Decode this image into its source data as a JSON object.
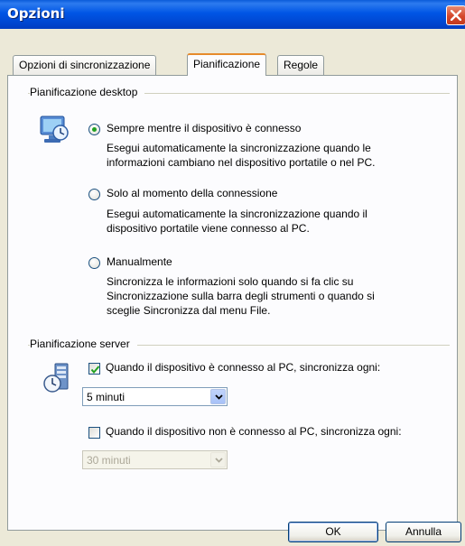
{
  "window": {
    "title": "Opzioni",
    "close_icon": "close-icon"
  },
  "tabs": [
    {
      "label": "Opzioni di sincronizzazione",
      "active": false
    },
    {
      "label": "Pianificazione",
      "active": true
    },
    {
      "label": "Regole",
      "active": false
    }
  ],
  "desktop": {
    "group_label": "Pianificazione desktop",
    "icon": "desktop-sync-clock-icon",
    "options": [
      {
        "label": "Sempre mentre il dispositivo è connesso",
        "checked": true,
        "description": [
          "Esegui automaticamente la sincronizzazione quando le",
          "informazioni cambiano nel dispositivo portatile o nel PC."
        ]
      },
      {
        "label": "Solo al momento della connessione",
        "checked": false,
        "description": [
          "Esegui automaticamente la sincronizzazione quando il",
          "dispositivo portatile viene connesso al PC."
        ]
      },
      {
        "label": "Manualmente",
        "checked": false,
        "description": [
          "Sincronizza le informazioni solo quando si fa clic su",
          "Sincronizzazione sulla barra degli strumenti o quando si",
          "sceglie Sincronizza dal menu File."
        ]
      }
    ]
  },
  "server": {
    "group_label": "Pianificazione server",
    "icon": "server-sync-clock-icon",
    "connected_checkbox": {
      "label": "Quando il dispositivo è connesso al PC, sincronizza ogni:",
      "checked": true
    },
    "connected_interval": {
      "value": "5 minuti",
      "enabled": true
    },
    "not_connected_checkbox": {
      "label": "Quando il dispositivo non è connesso al PC, sincronizza ogni:",
      "checked": false
    },
    "not_connected_interval": {
      "value": "30 minuti",
      "enabled": false
    }
  },
  "buttons": {
    "ok": "OK",
    "cancel": "Annulla"
  },
  "colors": {
    "titlebar": "#0055E5",
    "dialog_bg": "#ECE9D8",
    "panel_bg": "#FCFCFE",
    "active_tab_accent": "#E68B2C",
    "radio_dot": "#21A121"
  }
}
